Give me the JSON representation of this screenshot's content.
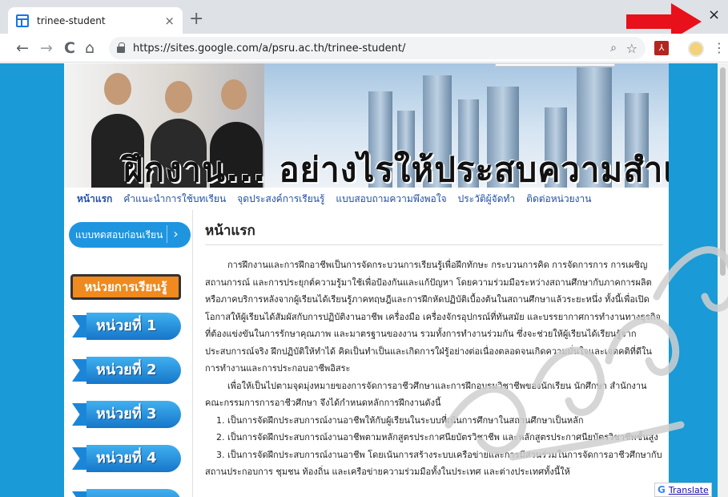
{
  "browser": {
    "tab_title": "trinee-student",
    "tab_close": "×",
    "new_tab": "+",
    "window_close": "×",
    "back": "←",
    "forward": "→",
    "reload": "C",
    "home": "⌂",
    "url": "https://sites.google.com/a/psru.ac.th/trinee-student/",
    "zoom_icon": "⌕",
    "star_icon": "☆",
    "pdf_icon": "⅄",
    "menu_icon": "⋮"
  },
  "banner": {
    "title": "ฝึกงาน...  อย่างไรให้ประสบความสำเร็จ"
  },
  "nav": {
    "items": [
      "หน้าแรก",
      "คำแนะนำการใช้บทเรียน",
      "จุดประสงค์การเรียนรู้",
      "แบบสอบถามความพึงพอใจ",
      "ประวัติผู้จัดทำ",
      "ติดต่อหน่วยงาน"
    ]
  },
  "sidebar": {
    "pretest_label": "แบบทดสอบก่อนเรียน",
    "pretest_chevron": "›",
    "units_header": "หน่วยการเรียนรู้",
    "units": [
      "หน่วยที่ 1",
      "หน่วยที่ 2",
      "หน่วยที่ 3",
      "หน่วยที่ 4"
    ]
  },
  "content": {
    "title": "หน้าแรก",
    "paragraph1": "การฝึกงานและการฝึกอาชีพเป็นการจัดกระบวนการเรียนรู้เพื่อฝึกทักษะ กระบวนการคิด การจัดการการ การเผชิญสถานการณ์ และการประยุกต์ความรู้มาใช้เพื่อป้องกันและแก้ปัญหา โดยความร่วมมือระหว่างสถานศึกษากับภาคการผลิตหรือภาคบริการหลังจากผู้เรียนได้เรียนรู้ภาคทฤษฎีและการฝึกหัดปฏิบัติเบื้องต้นในสถานศึกษาแล้วระยะหนึ่ง ทั้งนี้เพื่อเปิดโอกาสให้ผู้เรียนได้สัมผัสกับการปฏิบัติงานอาชีพ เครื่องมือ เครื่องจักรอุปกรณ์ที่ทันสมัย และบรรยากาศการทำงานทางธุรกิจที่ต้องแข่งขันในการรักษาคุณภาพ และมาตรฐานของงาน รวมทั้งการทำงานร่วมกัน ซึ่งจะช่วยให้ผู้เรียนได้เรียนรู้จากประสบการณ์จริง ฝึกปฏิบัติให้ทำได้ คิดเป็นทำเป็นและเกิดการใฝ่รู้อย่างต่อเนื่องตลอดจนเกิดความมั่นใจและเจตคติที่ดีในการทำงานและการประกอบอาชีพอิสระ",
    "paragraph2": "เพื่อให้เป็นไปตามจุดมุ่งหมายของการจัดการอาชีวศึกษาและการฝึกอบรมวิชาชีพของนักเรียน นักศึกษา สำนักงานคณะกรรมการการอาชีวศึกษา จึงได้กำหนดหลักการฝึกงานดังนี้",
    "item1": "1. เป็นการจัดฝึกประสบการณ์งานอาชีพให้กับผู้เรียนในระบบที่เน้นการศึกษาในสถานศึกษาเป็นหลัก",
    "item2": "2. เป็นการจัดฝึกประสบการณ์งานอาชีพตามหลักสูตรประกาศนียบัตรวิชาชีพ และหลักสูตรประกาศนียบัตรวิชาชีพชั้นสูง",
    "item3": "3. เป็นการจัดฝึกประสบการณ์งานอาชีพ โดยเน้นการสร้างระบบเครือข่ายและการมีส่วนร่วมในการจัดการอาชีวศึกษากับสถานประกอบการ ชุมชน ท้องถิ่น และเครือข่ายความร่วมมือทั้งในประเทศ และต่างประเทศทั้งนี้ให้"
  },
  "translate": {
    "icon": "G",
    "label": "Translate"
  },
  "colors": {
    "page_bg": "#1a9ad6",
    "nav_link": "#1f4fa8",
    "unit_button": "#1b86d8",
    "units_header": "#f08a1e",
    "annotation_arrow": "#e8101a"
  }
}
